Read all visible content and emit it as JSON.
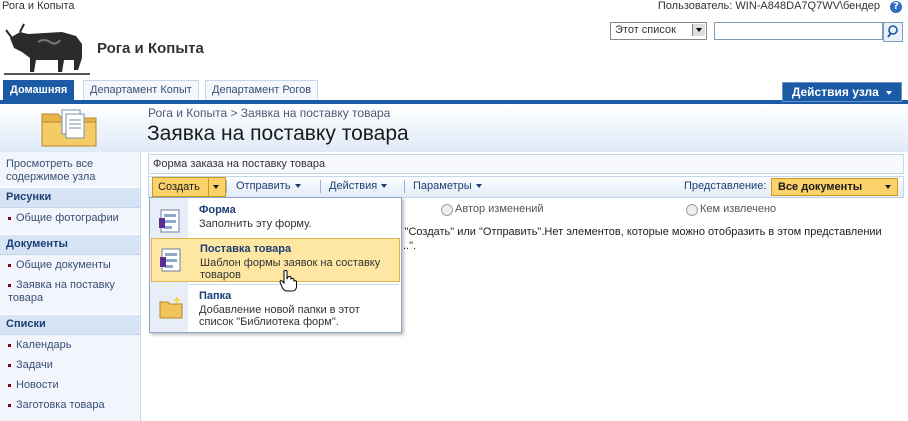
{
  "topbar": {
    "breadcrumb": "Рога и Копыта",
    "user": "Пользователь: WIN-A848DA7Q7WV\\бендер",
    "help_icon": "?"
  },
  "header": {
    "site_title": "Рога и Копыта",
    "scope_value": "Этот список",
    "search_value": ""
  },
  "tabs": [
    {
      "label": "Домашняя",
      "active": true
    },
    {
      "label": "Департамент Копыт",
      "active": false
    },
    {
      "label": "Департамент Рогов",
      "active": false
    }
  ],
  "site_actions": "Действия узла",
  "page": {
    "breadcrumb": "Рога и Копыта > Заявка на поставку товара",
    "title": "Заявка на поставку товара"
  },
  "leftnav": {
    "view_all": "Просмотреть все содержимое узла",
    "sections": [
      {
        "header": "Рисунки",
        "items": [
          "Общие фотографии"
        ]
      },
      {
        "header": "Документы",
        "items": [
          "Общие документы",
          "Заявка на поставку товара"
        ]
      },
      {
        "header": "Списки",
        "items": [
          "Календарь",
          "Задачи",
          "Новости",
          "Заготовка товара"
        ]
      }
    ]
  },
  "list": {
    "description": "Форма заказа на поставку товара",
    "toolbar": {
      "new": "Создать",
      "upload": "Отправить",
      "actions": "Действия",
      "settings": "Параметры",
      "view_label": "Представление:",
      "view_value": "Все документы"
    },
    "columns": [
      "Автор изменений",
      "Кем извлечено"
    ],
    "empty_message": "у \"Создать\" или \"Отправить\".Нет элементов, которые можно отобразить в этом представлении \"...\"."
  },
  "menu": {
    "items": [
      {
        "title": "Форма",
        "desc": "Заполнить эту форму."
      },
      {
        "title": "Поставка товара",
        "desc": "Шаблон формы заявок на составку товаров"
      },
      {
        "title": "Папка",
        "desc": "Добавление новой папки в этот список \"Библиотека форм\"."
      }
    ]
  },
  "colors": {
    "accent": "#1b5aa5",
    "highlight": "#fde7a3",
    "button": "#fbd36a"
  }
}
